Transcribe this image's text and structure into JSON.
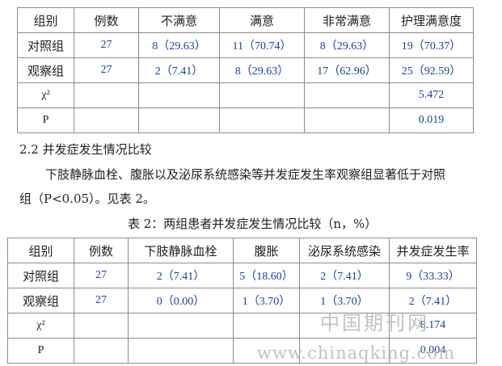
{
  "table1": {
    "headers": [
      "组别",
      "例数",
      "不满意",
      "满意",
      "非常满意",
      "护理满意度"
    ],
    "rows": [
      [
        "对照组",
        "27",
        "8（29.63）",
        "11（70.74）",
        "8（29.63）",
        "19（70.37）"
      ],
      [
        "观察组",
        "27",
        "2（7.41）",
        "8（29.63）",
        "17（62.96）",
        "25（92.59）"
      ]
    ],
    "chi_label": "χ²",
    "chi_value": "5.472",
    "p_label": "P",
    "p_value": "0.019"
  },
  "section_heading": "2.2 并发症发生情况比较",
  "paragraph_line1": "下肢静脉血栓、腹胀以及泌尿系统感染等并发症发生率观察组显著低于对照",
  "paragraph_line2": "组（P<0.05）。见表 2。",
  "table2_caption": "表 2：两组患者并发症发生情况比较（n，%）",
  "table2": {
    "headers": [
      "组别",
      "例数",
      "下肢静脉血栓",
      "腹胀",
      "泌尿系统感染",
      "并发症发生率"
    ],
    "rows": [
      [
        "对照组",
        "27",
        "2（7.41）",
        "5（18.60）",
        "2（7.41）",
        "9（33.33）"
      ],
      [
        "观察组",
        "27",
        "0（0.00）",
        "1（3.70）",
        "1（3.70）",
        "2（7.41）"
      ]
    ],
    "chi_label": "χ²",
    "chi_value": "8.174",
    "p_label": "P",
    "p_value": "0.004"
  },
  "watermark_cn": "中国期刊网",
  "watermark_url": "www.chinaqking.com"
}
